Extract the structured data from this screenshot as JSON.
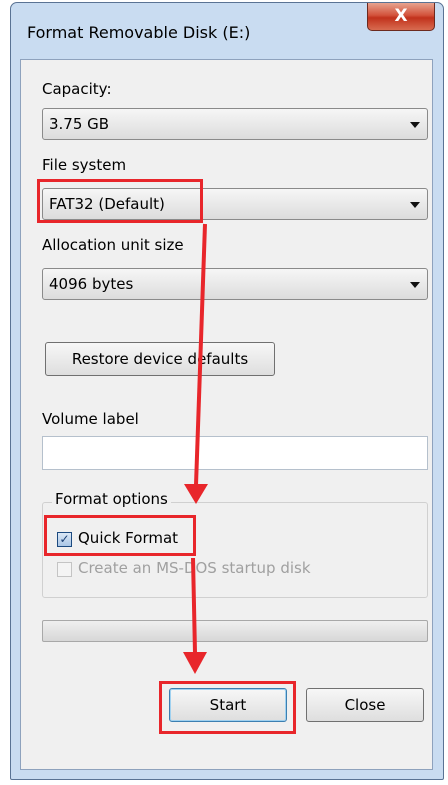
{
  "window": {
    "title": "Format Removable Disk (E:)",
    "close_glyph": "X"
  },
  "capacity": {
    "label": "Capacity:",
    "value": "3.75 GB"
  },
  "file_system": {
    "label": "File system",
    "value": "FAT32 (Default)"
  },
  "allocation": {
    "label": "Allocation unit size",
    "value": "4096 bytes"
  },
  "restore_button": "Restore device defaults",
  "volume_label": {
    "label": "Volume label",
    "value": ""
  },
  "format_options": {
    "title": "Format options",
    "quick_format": {
      "label": "Quick Format",
      "checked": true
    },
    "msdos": {
      "label": "Create an MS-DOS startup disk",
      "checked": false
    }
  },
  "progress": {
    "value": 0
  },
  "buttons": {
    "start": "Start",
    "close": "Close"
  },
  "colors": {
    "highlight": "#e8262b",
    "arrow": "#e8262b"
  }
}
